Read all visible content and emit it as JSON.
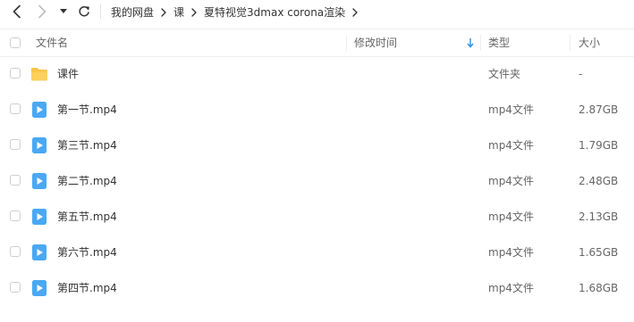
{
  "nav": {
    "back_icon": "chevron-left-icon",
    "forward_icon": "chevron-right-icon",
    "dropdown_icon": "caret-down-icon",
    "refresh_icon": "refresh-icon",
    "breadcrumb": [
      "我的网盘",
      "课",
      "夏特视觉3dmax corona渲染"
    ]
  },
  "header": {
    "name": "文件名",
    "mtime": "修改时间",
    "type": "类型",
    "size": "大小",
    "sort_icon": "arrow-down-icon"
  },
  "colors": {
    "sort_arrow": "#2a8ef0",
    "folder": "#f9c548",
    "video": "#4aa8f4"
  },
  "rows": [
    {
      "name": "课件",
      "type": "文件夹",
      "size": "-",
      "icon": "folder-icon"
    },
    {
      "name": "第一节.mp4",
      "type": "mp4文件",
      "size": "2.87GB",
      "icon": "video-file-icon"
    },
    {
      "name": "第三节.mp4",
      "type": "mp4文件",
      "size": "1.79GB",
      "icon": "video-file-icon"
    },
    {
      "name": "第二节.mp4",
      "type": "mp4文件",
      "size": "2.48GB",
      "icon": "video-file-icon"
    },
    {
      "name": "第五节.mp4",
      "type": "mp4文件",
      "size": "2.13GB",
      "icon": "video-file-icon"
    },
    {
      "name": "第六节.mp4",
      "type": "mp4文件",
      "size": "1.65GB",
      "icon": "video-file-icon"
    },
    {
      "name": "第四节.mp4",
      "type": "mp4文件",
      "size": "1.68GB",
      "icon": "video-file-icon"
    }
  ]
}
